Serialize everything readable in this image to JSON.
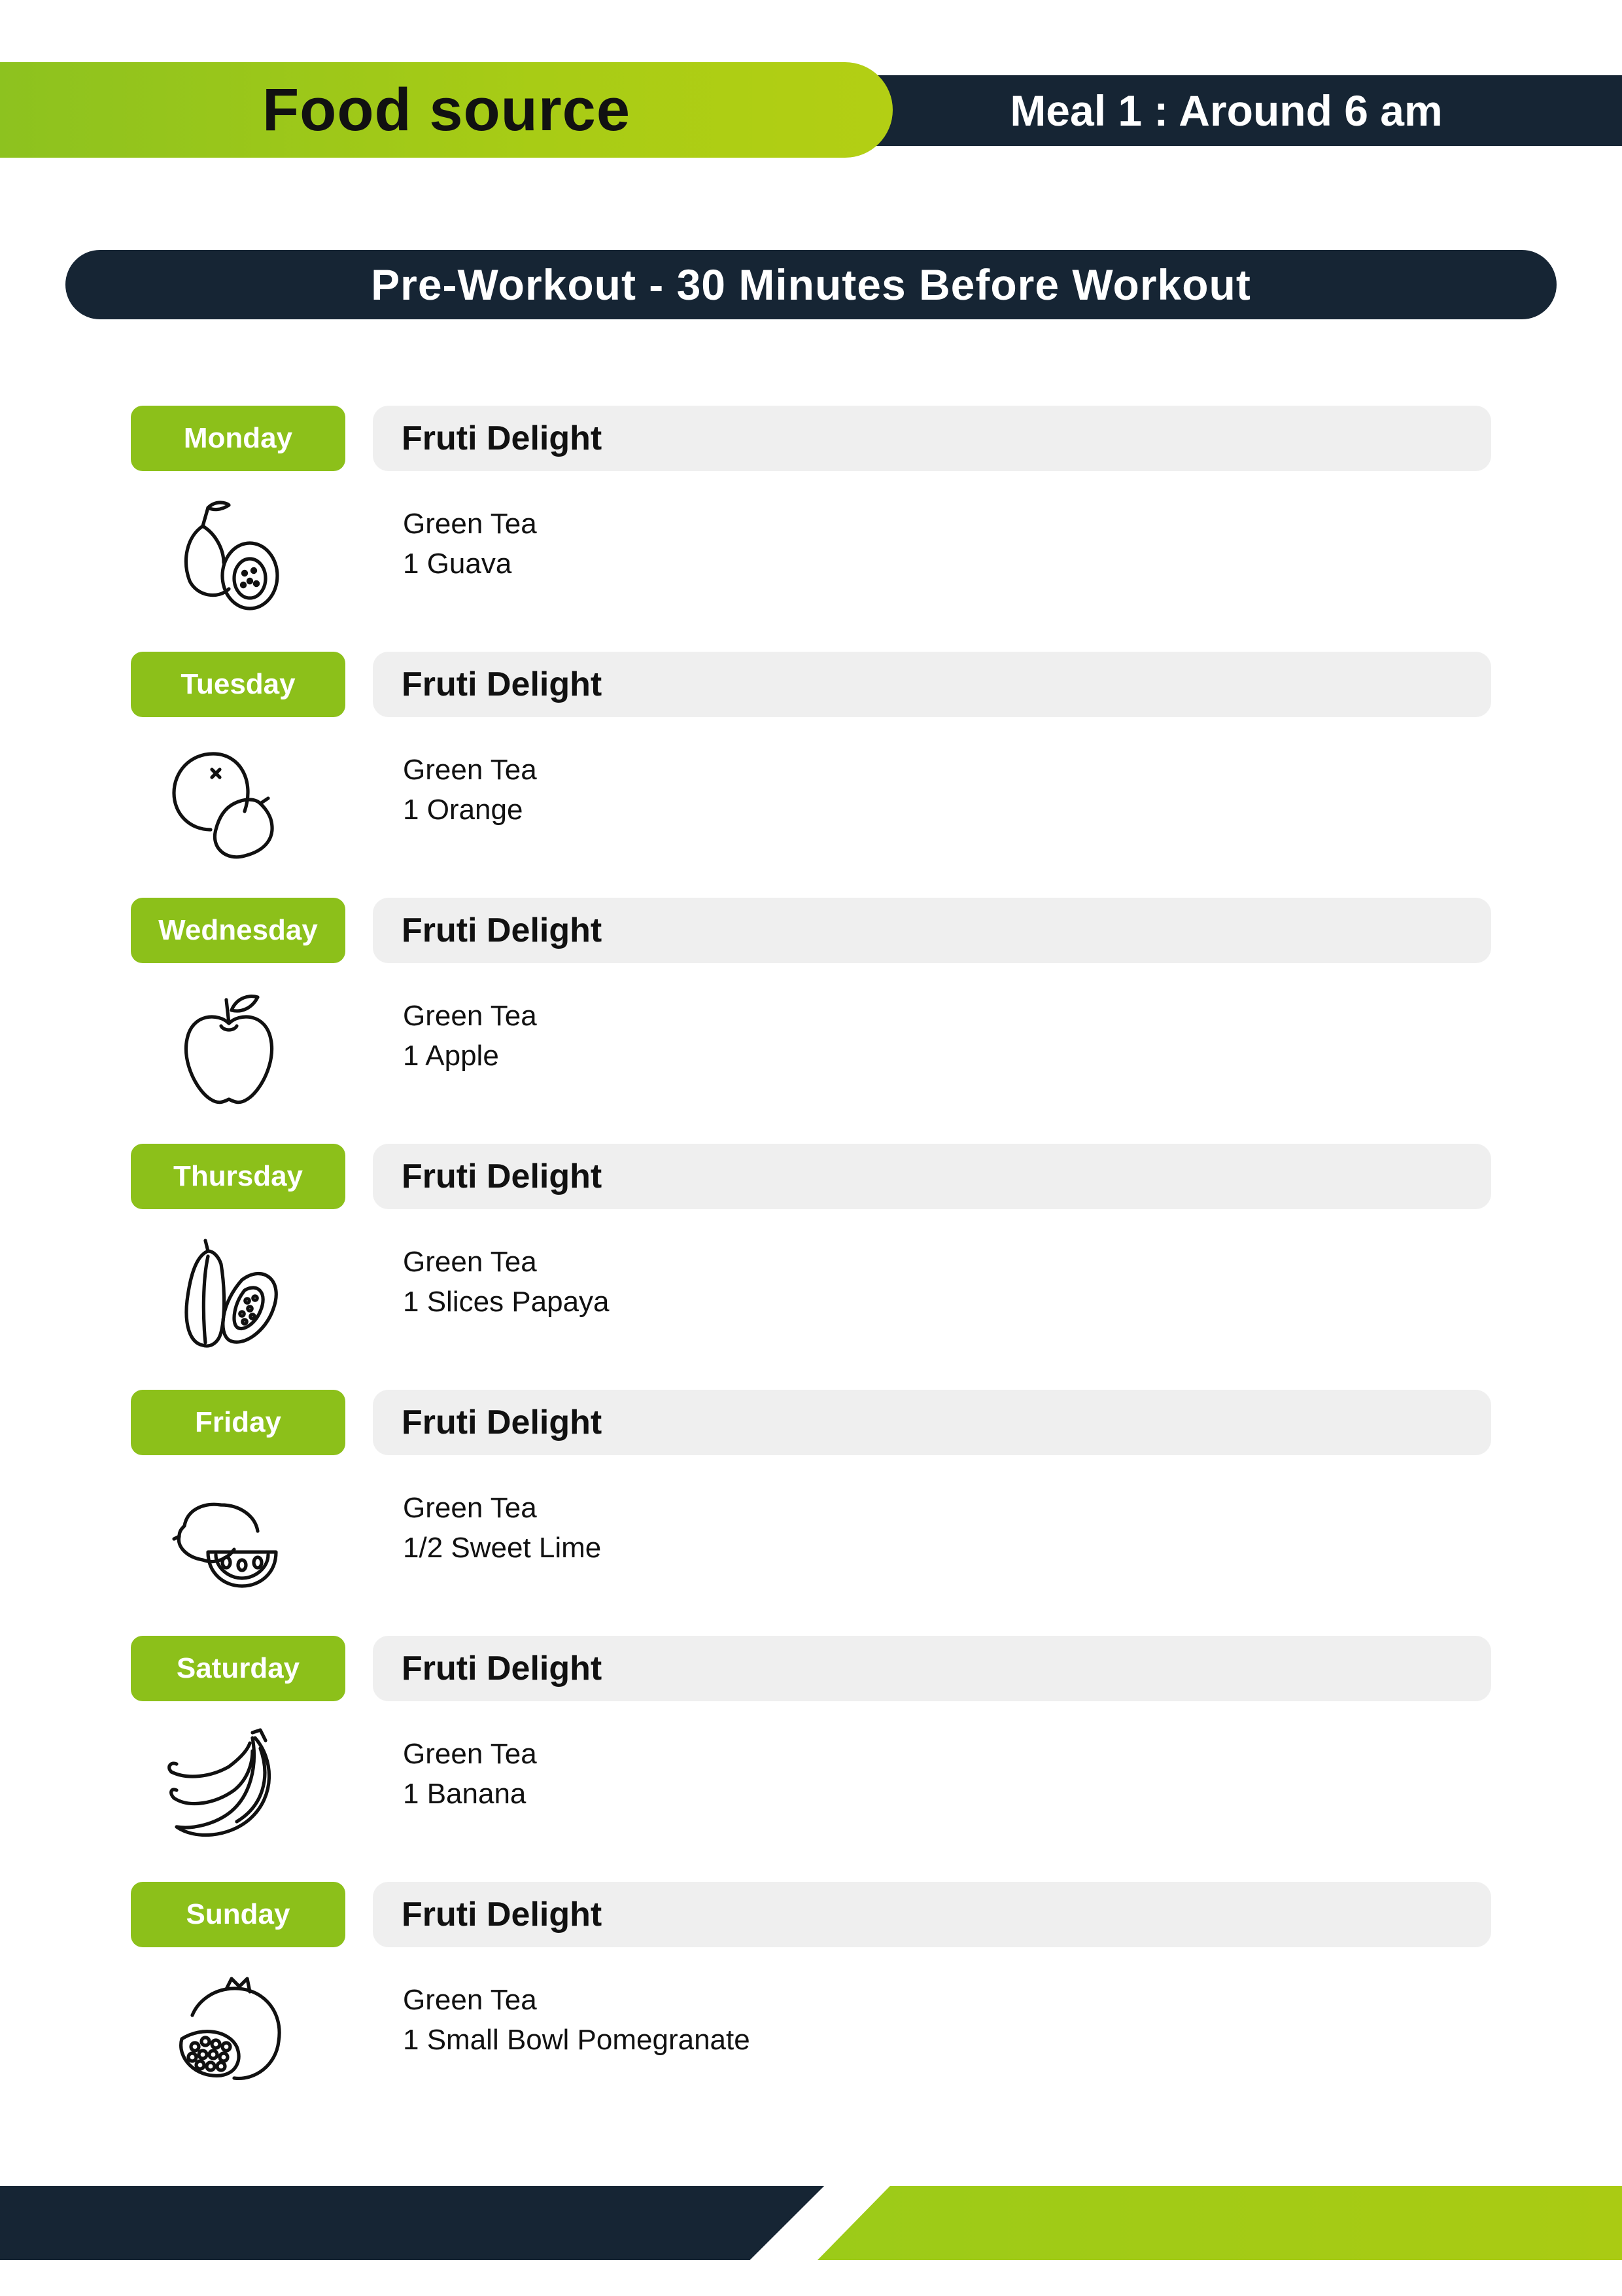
{
  "header": {
    "title": "Food source",
    "meal": "Meal 1 : Around 6 am"
  },
  "section": {
    "title": "Pre-Workout  - 30 Minutes Before Workout"
  },
  "days": [
    {
      "day": "Monday",
      "meal_name": "Fruti Delight",
      "items": [
        "Green Tea",
        "1 Guava"
      ],
      "icon": "guava-icon"
    },
    {
      "day": "Tuesday",
      "meal_name": "Fruti Delight",
      "items": [
        "Green Tea",
        "1 Orange"
      ],
      "icon": "orange-icon"
    },
    {
      "day": "Wednesday",
      "meal_name": "Fruti Delight",
      "items": [
        "Green Tea",
        "1 Apple"
      ],
      "icon": "apple-icon"
    },
    {
      "day": "Thursday",
      "meal_name": "Fruti Delight",
      "items": [
        "Green Tea",
        "1 Slices Papaya"
      ],
      "icon": "papaya-icon"
    },
    {
      "day": "Friday",
      "meal_name": "Fruti Delight",
      "items": [
        "Green Tea",
        "1/2 Sweet Lime"
      ],
      "icon": "sweet-lime-icon"
    },
    {
      "day": "Saturday",
      "meal_name": "Fruti Delight",
      "items": [
        "Green Tea",
        "1 Banana"
      ],
      "icon": "banana-icon"
    },
    {
      "day": "Sunday",
      "meal_name": "Fruti Delight",
      "items": [
        "Green Tea",
        "1 Small Bowl Pomegranate"
      ],
      "icon": "pomegranate-icon"
    }
  ],
  "colors": {
    "green": "#8cc01a",
    "navy": "#162534",
    "light_gray": "#efefef"
  }
}
